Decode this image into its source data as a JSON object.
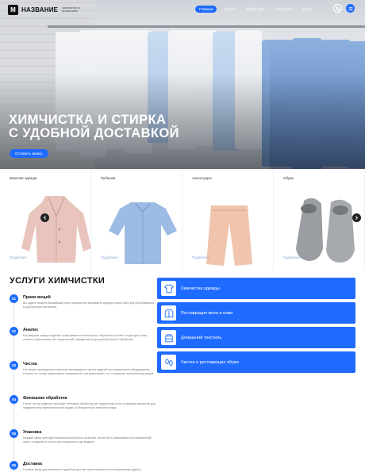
{
  "brand": {
    "logo_letter": "M",
    "name": "НАЗВАНИЕ",
    "tagline": "химчистка и прачечная"
  },
  "nav": {
    "items": [
      {
        "label": "Главная",
        "active": true
      },
      {
        "label": "Услуги",
        "active": false
      },
      {
        "label": "Прайс-лист",
        "active": false
      },
      {
        "label": "Контакты",
        "active": false
      },
      {
        "label": "О нас",
        "active": false
      }
    ],
    "icons": [
      "phone-icon",
      "menu-icon"
    ]
  },
  "hero": {
    "title_line1": "ХИМЧИСТКА И СТИРКА",
    "title_line2": "С УДОБНОЙ ДОСТАВКОЙ",
    "cta": "Оставить заявку"
  },
  "categories": [
    {
      "title": "Верхняя одежда",
      "link": "Подробнее",
      "item": "coat"
    },
    {
      "title": "Рубашки",
      "link": "Подробнее",
      "item": "shirt"
    },
    {
      "title": "Аксессуары",
      "link": "Подробнее",
      "item": "trousers"
    },
    {
      "title": "Обувь",
      "link": "Подробнее",
      "item": "shoes"
    }
  ],
  "services": {
    "title": "УСЛУГИ ХИМЧИСТКИ",
    "steps": [
      {
        "num": "01",
        "title": "Прием вещей",
        "desc": "Вы сдаете вещи в ближайший пункт приема или вызываете курьера через сайт для обслуживания в удобное для вас время."
      },
      {
        "num": "02",
        "title": "Анализ",
        "desc": "На фабрике каждое изделие осматривается технологом. Изучается состав и структура ткани, степень загрязнения, тип загрязнений, определяется доступный способ обработки."
      },
      {
        "num": "03",
        "title": "Чистка",
        "desc": "На основе проведенного анализа производится чистка изделий на специальном оборудовании, которое не только эффективно справляется с загрязнениями, но и сохраняет внешний вид вещей."
      },
      {
        "num": "04",
        "title": "Финишная обработка",
        "desc": "После чистки изделие проходит тепловую обработку на гладильном столе и паровом манекене для придания ему первоначальной формы и безупречного внешнего вида."
      },
      {
        "num": "05",
        "title": "Упаковка",
        "desc": "Каждый заказ проходит финальный контроль качества, после чего упаковывается в фирменный пакет, а изделия в чехлы для сохранности до выдачи."
      },
      {
        "num": "06",
        "title": "Доставка",
        "desc": "Готовые вещи доставляются в удобный для вас пункт приема или по указанному адресу."
      }
    ],
    "cards": [
      {
        "label": "Химчистка одежды",
        "icon": "shirt-icon"
      },
      {
        "label": "Реставрация меха и кожи",
        "icon": "jacket-icon"
      },
      {
        "label": "Домашний текстиль",
        "icon": "textile-icon"
      },
      {
        "label": "Чистка и реставрация обуви",
        "icon": "footprints-icon"
      }
    ]
  },
  "colors": {
    "accent": "#1f6bff",
    "dark": "#111111"
  }
}
